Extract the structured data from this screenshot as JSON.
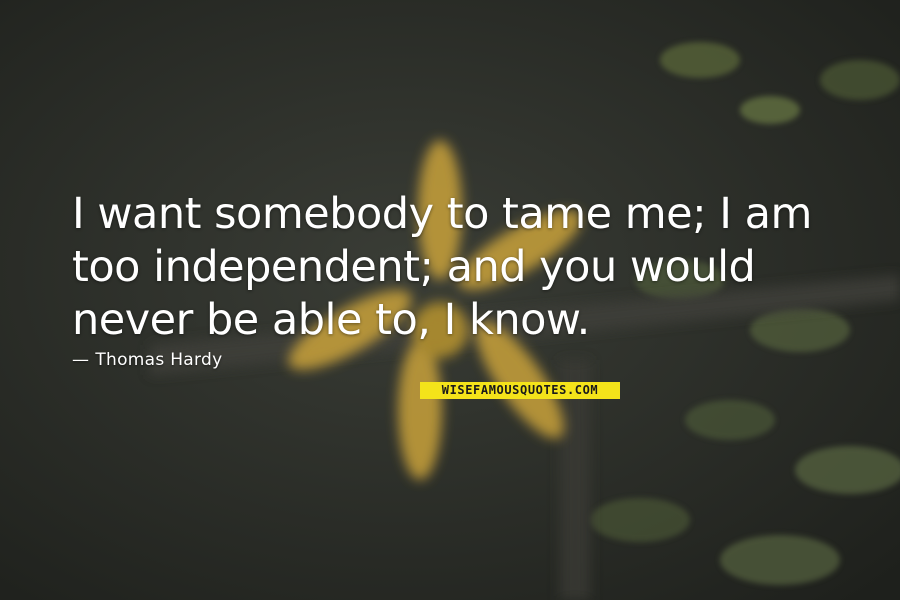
{
  "quote": {
    "lines": [
      "I want somebody to tame me; I am",
      "too independent; and you would",
      "never be able to, I know."
    ]
  },
  "author": {
    "dash": "—",
    "name": "Thomas Hardy"
  },
  "watermark": {
    "text": "WISEFAMOUSQUOTES.COM"
  },
  "colors": {
    "text": "#ffffff",
    "watermark_bg": "#f4e31a",
    "flower": "#c9a23a"
  }
}
